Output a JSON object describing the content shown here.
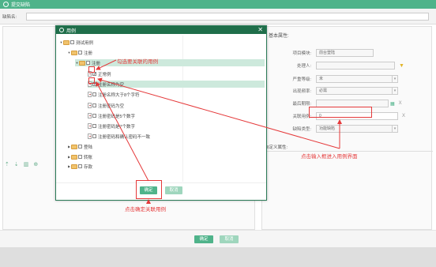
{
  "window": {
    "title": "提交缺陷"
  },
  "form": {
    "defect_name_label": "缺陷名:"
  },
  "right_panel": {
    "section_title": "基本属性:",
    "fields": {
      "module": {
        "label": "项目模块:",
        "value": "前台登陆"
      },
      "handler": {
        "label": "处理人:",
        "value": ""
      },
      "severity": {
        "label": "严重等级:",
        "value": "未"
      },
      "frequency": {
        "label": "出现频率:",
        "value": "必需"
      },
      "deadline": {
        "label": "最后期限:",
        "value": ""
      },
      "linked_case": {
        "label": "关联用例:",
        "value": "0"
      },
      "defect_type": {
        "label": "缺陷类型:",
        "value": "功能缺陷"
      }
    },
    "custom_title": "自定义属性:"
  },
  "dialog": {
    "title": "用例",
    "confirm_label": "确定",
    "cancel_label": "取消",
    "tree": [
      {
        "label": "测试用例"
      },
      {
        "label": "注册"
      },
      {
        "label": "注册"
      },
      {
        "label": "正常例",
        "checked": true
      },
      {
        "label": "注册名称为空",
        "checked": true
      },
      {
        "label": "注册名称大于8个字符",
        "checked": false
      },
      {
        "label": "注册密码为空",
        "checked": false
      },
      {
        "label": "注册密码是5个数字",
        "checked": false
      },
      {
        "label": "注册密码是7个数字",
        "checked": false
      },
      {
        "label": "注册密码和确认密码不一致",
        "checked": false
      },
      {
        "label": "登陆"
      },
      {
        "label": "转账"
      },
      {
        "label": "存款"
      }
    ]
  },
  "main_buttons": {
    "confirm_label": "确定",
    "cancel_label": "取消"
  },
  "annotations": {
    "select_cases": "勾选要关联的用例",
    "click_input": "点击输入框进入用例界面",
    "click_confirm": "点击确定关联用例"
  },
  "colors": {
    "accent": "#4fb38a",
    "dialog_header": "#1f6e4a",
    "annotation": "#e5393a"
  }
}
